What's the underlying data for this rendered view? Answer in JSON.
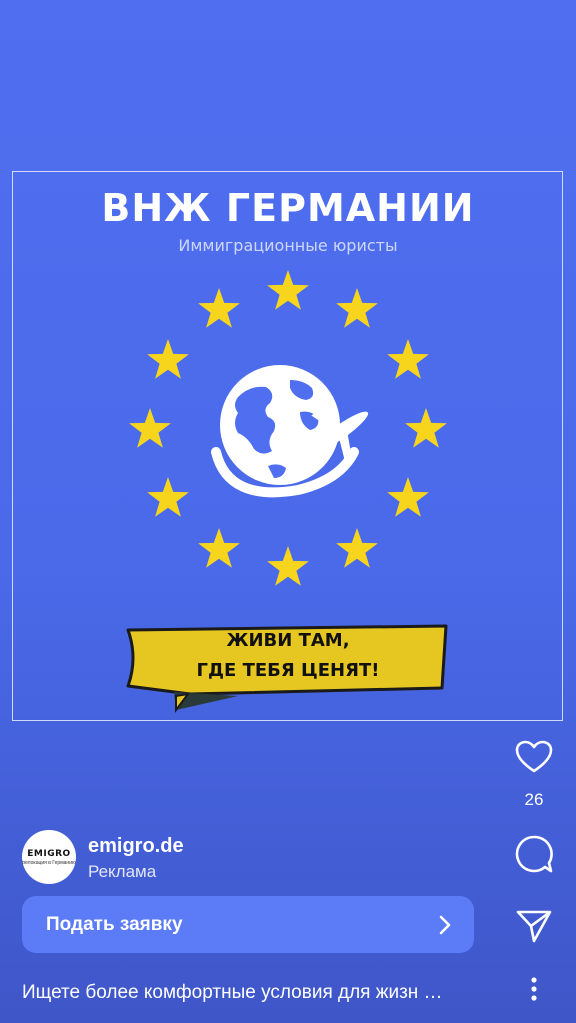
{
  "ad": {
    "headline": "ВНЖ ГЕРМАНИИ",
    "subheadline": "Иммиграционные юристы",
    "banner_line1": "ЖИВИ ТАМ,",
    "banner_line2": "ГДЕ ТЕБЯ ЦЕНЯТ!",
    "colors": {
      "star": "#f7d51d",
      "banner": "#e6c620",
      "background": "#4f6ff0"
    }
  },
  "actions": {
    "like_icon": "heart-icon",
    "like_count": "26",
    "comment_icon": "comment-icon",
    "share_icon": "send-icon",
    "more_icon": "more-vertical-icon"
  },
  "account": {
    "avatar_brand": "EMIGRO",
    "avatar_tagline": "релокация в Германию",
    "name": "emigro.de",
    "label": "Реклама"
  },
  "cta": {
    "label": "Подать заявку",
    "icon": "chevron-right-icon"
  },
  "caption": "Ищете более комфортные условия для жизн …"
}
